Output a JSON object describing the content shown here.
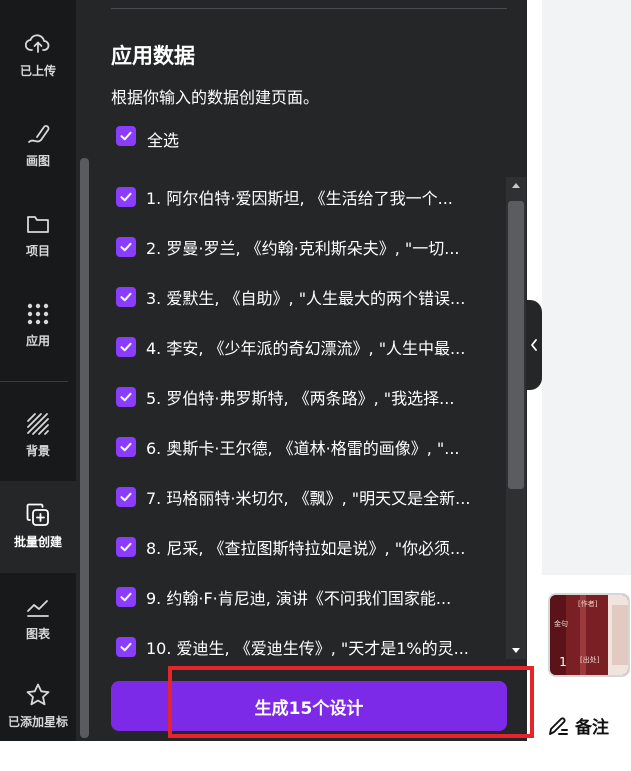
{
  "sidebar": {
    "items": [
      {
        "label": "已上传",
        "icon": "cloud-upload-icon"
      },
      {
        "label": "画图",
        "icon": "draw-icon"
      },
      {
        "label": "项目",
        "icon": "folder-icon"
      },
      {
        "label": "应用",
        "icon": "apps-grid-icon"
      },
      {
        "label": "背景",
        "icon": "background-pattern-icon"
      },
      {
        "label": "批量创建",
        "icon": "bulk-create-icon",
        "active": true
      },
      {
        "label": "图表",
        "icon": "chart-icon"
      },
      {
        "label": "已添加星标",
        "icon": "star-icon"
      }
    ]
  },
  "panel": {
    "title": "应用数据",
    "subtitle": "根据你输入的数据创建页面。",
    "select_all": {
      "label": "全选",
      "checked": true
    },
    "rows": [
      {
        "text": "1. 阿尔伯特·爱因斯坦, 《生活给了我一个...",
        "checked": true
      },
      {
        "text": "2. 罗曼·罗兰, 《约翰·克利斯朵夫》, \"一切...",
        "checked": true
      },
      {
        "text": "3. 爱默生, 《自助》, \"人生最大的两个错误...",
        "checked": true
      },
      {
        "text": "4. 李安, 《少年派的奇幻漂流》, \"人生中最...",
        "checked": true
      },
      {
        "text": "5. 罗伯特·弗罗斯特, 《两条路》, \"我选择...",
        "checked": true
      },
      {
        "text": "6. 奥斯卡·王尔德, 《道林·格雷的画像》, \"...",
        "checked": true
      },
      {
        "text": "7. 玛格丽特·米切尔, 《飘》, \"明天又是全新...",
        "checked": true
      },
      {
        "text": "8. 尼采, 《查拉图斯特拉如是说》, \"你必须...",
        "checked": true
      },
      {
        "text": "9. 约翰·F·肯尼迪, 演讲《不问我们国家能...",
        "checked": true
      },
      {
        "text": "10. 爱迪生, 《爱迪生传》, \"天才是1%的灵...",
        "checked": true
      }
    ],
    "generate_button": "生成15个设计"
  },
  "thumbnail": {
    "page_number": "1",
    "tag_author": "[作者]",
    "tag_quote": "金句",
    "tag_source": "[出处]"
  },
  "notes": {
    "label": "备注",
    "icon": "notes-pencil-icon"
  },
  "colors": {
    "accent": "#8b3dff",
    "button": "#7d2ae8",
    "highlight": "#e4252b",
    "panel_bg": "#252627",
    "rail_bg": "#18191b"
  }
}
